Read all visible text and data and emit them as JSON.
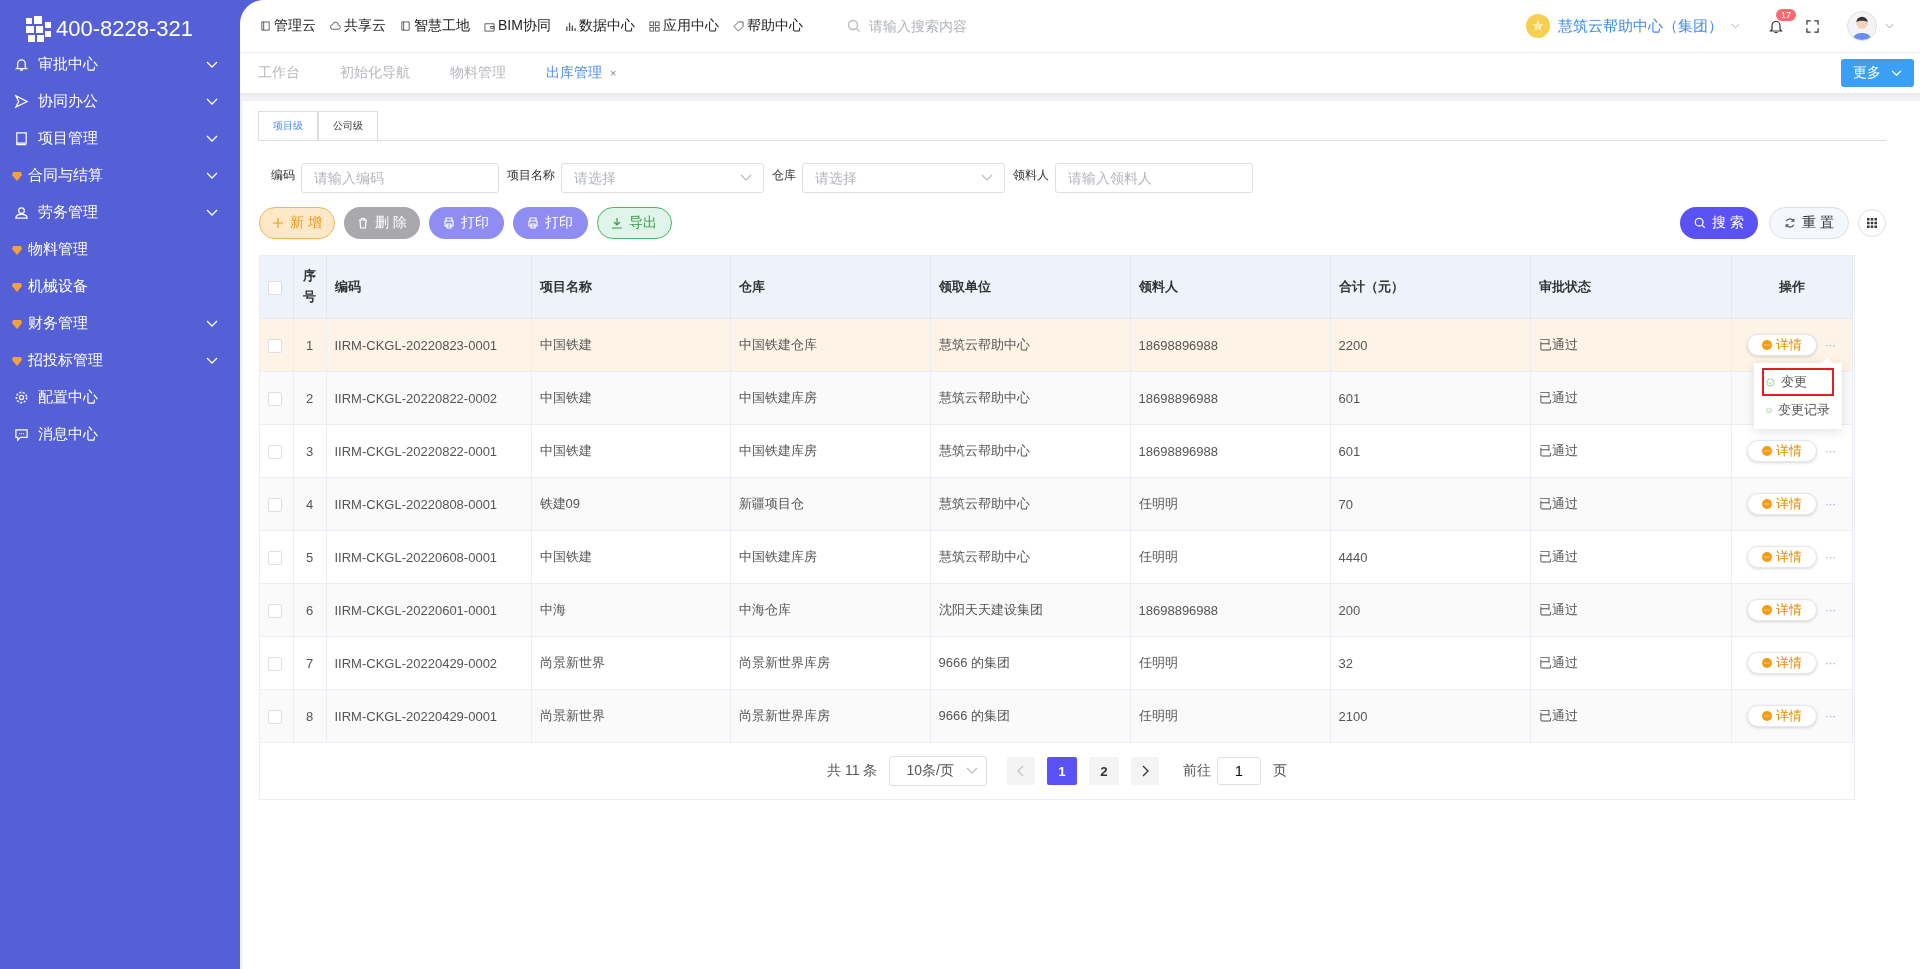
{
  "logo": {
    "phone": "400-8228-321"
  },
  "sidebar": {
    "items": [
      {
        "label": "审批中心",
        "kind": "bell",
        "expandable": true
      },
      {
        "label": "协同办公",
        "kind": "send",
        "expandable": true
      },
      {
        "label": "项目管理",
        "kind": "book",
        "expandable": true
      },
      {
        "label": "合同与结算",
        "kind": "gem",
        "expandable": true
      },
      {
        "label": "劳务管理",
        "kind": "user",
        "expandable": true
      },
      {
        "label": "物料管理",
        "kind": "gem",
        "expandable": false
      },
      {
        "label": "机械设备",
        "kind": "gem",
        "expandable": false
      },
      {
        "label": "财务管理",
        "kind": "gem",
        "expandable": true
      },
      {
        "label": "招投标管理",
        "kind": "gem",
        "expandable": true
      },
      {
        "label": "配置中心",
        "kind": "gear",
        "expandable": false
      },
      {
        "label": "消息中心",
        "kind": "chat",
        "expandable": false
      }
    ]
  },
  "top_nav": [
    {
      "label": "管理云",
      "kind": "book"
    },
    {
      "label": "共享云",
      "kind": "cloud"
    },
    {
      "label": "智慧工地",
      "kind": "book"
    },
    {
      "label": "BIM协同",
      "kind": "wallet"
    },
    {
      "label": "数据中心",
      "kind": "bars"
    },
    {
      "label": "应用中心",
      "kind": "grid"
    },
    {
      "label": "帮助中心",
      "kind": "tag"
    }
  ],
  "search": {
    "placeholder": "请输入搜索内容"
  },
  "org": {
    "name": "慧筑云帮助中心（集团）"
  },
  "notifications": {
    "count": "17"
  },
  "page_tabs": [
    {
      "label": "工作台",
      "selected": false
    },
    {
      "label": "初始化导航",
      "selected": false
    },
    {
      "label": "物料管理",
      "selected": false
    },
    {
      "label": "出库管理",
      "selected": true,
      "close": "×"
    }
  ],
  "more_button": "更多",
  "level_tabs": [
    {
      "label": "项目级",
      "selected": true
    },
    {
      "label": "公司级",
      "selected": false
    }
  ],
  "filters": [
    {
      "label": "编码",
      "kind": "input",
      "placeholder": "请输入编码"
    },
    {
      "label": "项目名称",
      "kind": "select",
      "placeholder": "请选择"
    },
    {
      "label": "仓库",
      "kind": "select",
      "placeholder": "请选择"
    },
    {
      "label": "领料人",
      "kind": "input",
      "placeholder": "请输入领料人"
    }
  ],
  "actions": [
    {
      "label": "新 增",
      "kind": "add"
    },
    {
      "label": "删 除",
      "kind": "delete"
    },
    {
      "label": "打印",
      "kind": "print"
    },
    {
      "label": "打印",
      "kind": "print"
    },
    {
      "label": "导出",
      "kind": "export"
    }
  ],
  "search_button": "搜 索",
  "reset_button": "重 置",
  "table": {
    "columns": [
      "序号",
      "编码",
      "项目名称",
      "仓库",
      "领取单位",
      "领料人",
      "合计（元）",
      "审批状态",
      "操作"
    ],
    "all_checked": false,
    "rows": [
      {
        "index": "1",
        "code": "IIRM-CKGL-20220823-0001",
        "project": "中国铁建",
        "warehouse": "中国铁建仓库",
        "unit": "慧筑云帮助中心",
        "person": "18698896988",
        "total": "2200",
        "status": "已通过",
        "detail": "详情",
        "more": "···",
        "hovered": true,
        "checked": false,
        "menu": [
          {
            "label": "变更",
            "highlighted": true
          },
          {
            "label": "变更记录",
            "highlighted": false
          }
        ]
      },
      {
        "index": "2",
        "code": "IIRM-CKGL-20220822-0002",
        "project": "中国铁建",
        "warehouse": "中国铁建库房",
        "unit": "慧筑云帮助中心",
        "person": "18698896988",
        "total": "601",
        "status": "已通过",
        "hovered": false,
        "checked": false
      },
      {
        "index": "3",
        "code": "IIRM-CKGL-20220822-0001",
        "project": "中国铁建",
        "warehouse": "中国铁建库房",
        "unit": "慧筑云帮助中心",
        "person": "18698896988",
        "total": "601",
        "status": "已通过",
        "detail": "详情",
        "more": "···",
        "hovered": false,
        "checked": false
      },
      {
        "index": "4",
        "code": "IIRM-CKGL-20220808-0001",
        "project": "铁建09",
        "warehouse": "新疆项目仓",
        "unit": "慧筑云帮助中心",
        "person": "任明明",
        "total": "70",
        "status": "已通过",
        "detail": "详情",
        "more": "···",
        "hovered": false,
        "checked": false
      },
      {
        "index": "5",
        "code": "IIRM-CKGL-20220608-0001",
        "project": "中国铁建",
        "warehouse": "中国铁建库房",
        "unit": "慧筑云帮助中心",
        "person": "任明明",
        "total": "4440",
        "status": "已通过",
        "detail": "详情",
        "more": "···",
        "hovered": false,
        "checked": false
      },
      {
        "index": "6",
        "code": "IIRM-CKGL-20220601-0001",
        "project": "中海",
        "warehouse": "中海仓库",
        "unit": "沈阳天天建设集团",
        "person": "18698896988",
        "total": "200",
        "status": "已通过",
        "detail": "详情",
        "more": "···",
        "hovered": false,
        "checked": false
      },
      {
        "index": "7",
        "code": "IIRM-CKGL-20220429-0002",
        "project": "尚景新世界",
        "warehouse": "尚景新世界库房",
        "unit": "9666 的集团",
        "person": "任明明",
        "total": "32",
        "status": "已通过",
        "detail": "详情",
        "more": "···",
        "hovered": false,
        "checked": false
      },
      {
        "index": "8",
        "code": "IIRM-CKGL-20220429-0001",
        "project": "尚景新世界",
        "warehouse": "尚景新世界库房",
        "unit": "9666 的集团",
        "person": "任明明",
        "total": "2100",
        "status": "已通过",
        "detail": "详情",
        "more": "···",
        "hovered": false,
        "checked": false
      }
    ]
  },
  "pagination": {
    "total": "共 11 条",
    "page_size": "10条/页",
    "pages": [
      {
        "label": "1",
        "selected": true
      },
      {
        "label": "2",
        "selected": false
      }
    ],
    "goto": "前往",
    "goto_value": "1",
    "goto_suffix": "页"
  }
}
